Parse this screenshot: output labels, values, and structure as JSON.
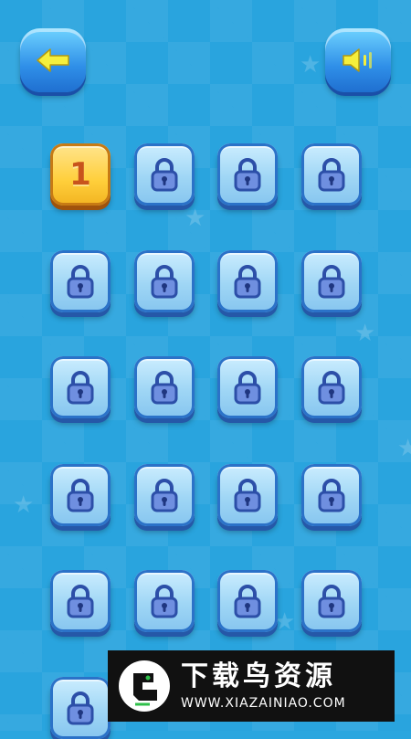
{
  "header": {
    "back_icon": "arrow-left-icon",
    "sound_icon": "speaker-icon"
  },
  "levels": [
    {
      "label": "1",
      "locked": false
    },
    {
      "label": "",
      "locked": true
    },
    {
      "label": "",
      "locked": true
    },
    {
      "label": "",
      "locked": true
    },
    {
      "label": "",
      "locked": true
    },
    {
      "label": "",
      "locked": true
    },
    {
      "label": "",
      "locked": true
    },
    {
      "label": "",
      "locked": true
    },
    {
      "label": "",
      "locked": true
    },
    {
      "label": "",
      "locked": true
    },
    {
      "label": "",
      "locked": true
    },
    {
      "label": "",
      "locked": true
    },
    {
      "label": "",
      "locked": true
    },
    {
      "label": "",
      "locked": true
    },
    {
      "label": "",
      "locked": true
    },
    {
      "label": "",
      "locked": true
    },
    {
      "label": "",
      "locked": true
    },
    {
      "label": "",
      "locked": true
    },
    {
      "label": "",
      "locked": true
    },
    {
      "label": "",
      "locked": true
    },
    {
      "label": "",
      "locked": true
    }
  ],
  "watermark": {
    "title": "下载鸟资源",
    "url": "WWW.XIAZAINIAO.COM"
  },
  "colors": {
    "background": "#29a4de",
    "locked_tile": "#9fd6f5",
    "unlocked_tile": "#ffcf3b",
    "level_number": "#c8531c"
  }
}
